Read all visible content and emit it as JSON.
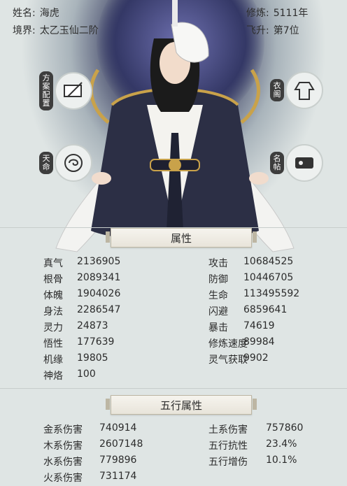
{
  "header": {
    "name_label": "姓名:",
    "name_value": "海虎",
    "realm_label": "境界:",
    "realm_value": "太乙玉仙二阶",
    "cultivation_label": "修炼:",
    "cultivation_value": "5111年",
    "ascend_label": "飞升:",
    "ascend_value": "第7位"
  },
  "side_buttons": {
    "left_top_label": "方案配置",
    "left_bottom_label": "天命",
    "right_top_label": "衣阁",
    "right_bottom_label": "名帖"
  },
  "attributes": {
    "title": "属性",
    "left": [
      {
        "k": "真气",
        "v": "2136905"
      },
      {
        "k": "根骨",
        "v": "2089341"
      },
      {
        "k": "体魄",
        "v": "1904026"
      },
      {
        "k": "身法",
        "v": "2286547"
      },
      {
        "k": "灵力",
        "v": "24873"
      },
      {
        "k": "悟性",
        "v": "177639"
      },
      {
        "k": "机缘",
        "v": "19805"
      },
      {
        "k": "神烙",
        "v": "100"
      }
    ],
    "right": [
      {
        "k": "攻击",
        "v": "10684525"
      },
      {
        "k": "防御",
        "v": "10446705"
      },
      {
        "k": "生命",
        "v": "113495592"
      },
      {
        "k": "闪避",
        "v": "6859641"
      },
      {
        "k": "暴击",
        "v": "74619"
      },
      {
        "k": "修炼速度",
        "v": "89984"
      },
      {
        "k": "灵气获取",
        "v": "9902"
      }
    ]
  },
  "elements": {
    "title": "五行属性",
    "left": [
      {
        "k": "金系伤害",
        "v": "740914"
      },
      {
        "k": "木系伤害",
        "v": "2607148"
      },
      {
        "k": "水系伤害",
        "v": "779896"
      },
      {
        "k": "火系伤害",
        "v": "731174"
      }
    ],
    "right": [
      {
        "k": "土系伤害",
        "v": "757860"
      },
      {
        "k": "五行抗性",
        "v": "23.4%"
      },
      {
        "k": "五行增伤",
        "v": "10.1%"
      }
    ]
  },
  "colors": {
    "background": "#dfe5e4",
    "accent_gold": "#c9a24a",
    "robe_dark": "#2c2f45"
  }
}
